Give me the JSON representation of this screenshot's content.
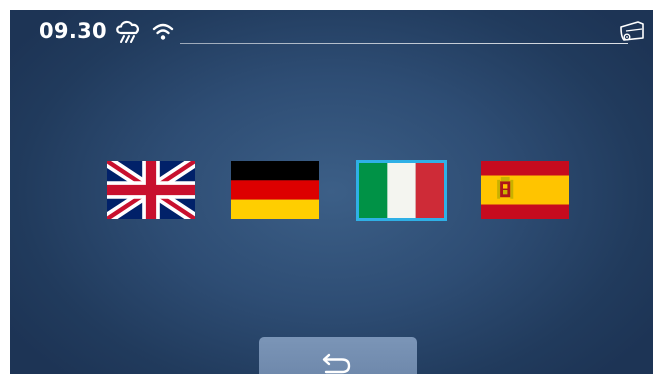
{
  "status": {
    "time": "09.30",
    "weather_icon": "rain-cloud-icon",
    "wifi_icon": "wifi-icon",
    "device_icon": "robot-mower-icon"
  },
  "languages": [
    {
      "flag": "uk-flag",
      "selected": false
    },
    {
      "flag": "germany-flag",
      "selected": false
    },
    {
      "flag": "italy-flag",
      "selected": true
    },
    {
      "flag": "spain-flag",
      "selected": false
    }
  ],
  "footer": {
    "back_icon": "back-arrow-icon"
  },
  "colors": {
    "background": "#2e4d74",
    "selection_border": "#2fb0e6",
    "back_button": "#7590b3"
  }
}
